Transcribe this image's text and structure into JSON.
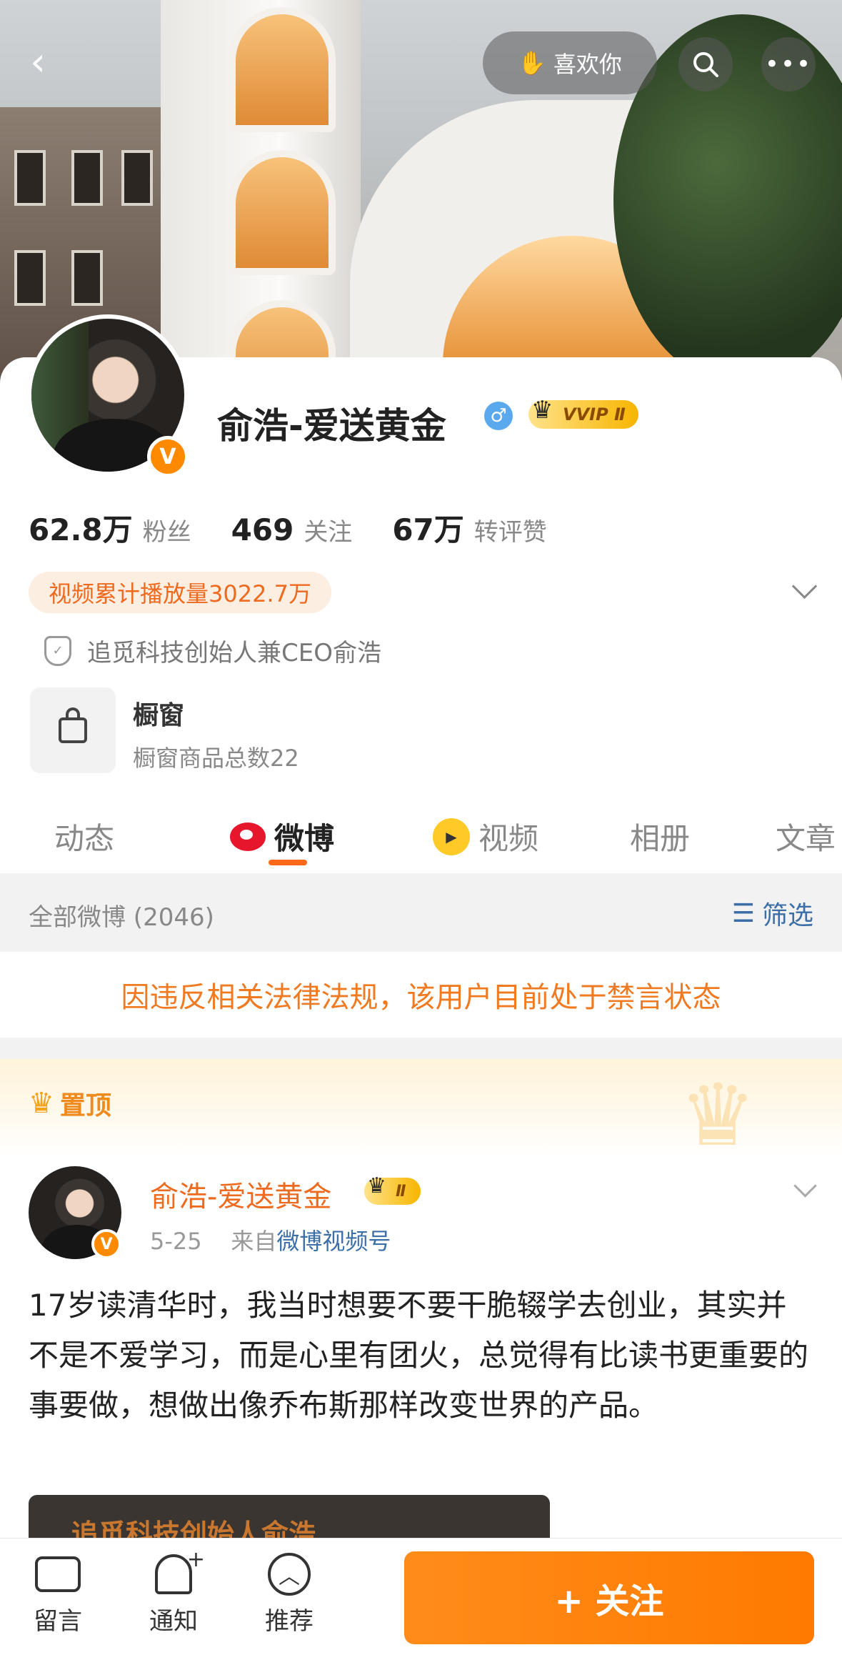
{
  "topbar": {
    "back_icon": "‹",
    "like_label": "喜欢你",
    "search_icon": "search-icon",
    "more_icon": "•••"
  },
  "profile": {
    "name": "俞浩-爱送黄金",
    "gender_symbol": "♂",
    "vip_label": "VVIP Ⅱ",
    "verified_badge": "V",
    "stats": [
      {
        "value": "62.8万",
        "label": "粉丝"
      },
      {
        "value": "469",
        "label": "关注"
      },
      {
        "value": "67万",
        "label": "转评赞"
      }
    ],
    "play_count": "视频累计播放量3022.7万",
    "verification": "追觅科技创始人兼CEO俞浩",
    "shop": {
      "title": "橱窗",
      "subtitle": "橱窗商品总数22"
    }
  },
  "tabs": [
    {
      "label": "动态"
    },
    {
      "label": "微博"
    },
    {
      "label": "视频"
    },
    {
      "label": "相册"
    },
    {
      "label": "文章"
    }
  ],
  "filterbar": {
    "count_label": "全部微博 (2046)",
    "filter_label": "筛选"
  },
  "banned_notice": "因违反相关法律法规，该用户目前处于禁言状态",
  "pinned_label": "置顶",
  "post": {
    "author": "俞浩-爱送黄金",
    "vip_label": "Ⅱ",
    "date": "5-25",
    "source_prefix": "来自",
    "source": "微博视频号",
    "text": "17岁读清华时，我当时想要不要干脆辍学去创业，其实并不是不爱学习，而是心里有团火，总觉得有比读书更重要的事要做，想做出像乔布斯那样改变世界的产品。",
    "media_caption": "追觅科技创始人俞浩"
  },
  "bottombar": {
    "items": [
      {
        "label": "留言"
      },
      {
        "label": "通知"
      },
      {
        "label": "推荐"
      }
    ],
    "follow_label": "+ 关注"
  },
  "colors": {
    "accent": "#ff7a00",
    "link": "#3c6fa8",
    "name_orange": "#ee6a1f"
  }
}
